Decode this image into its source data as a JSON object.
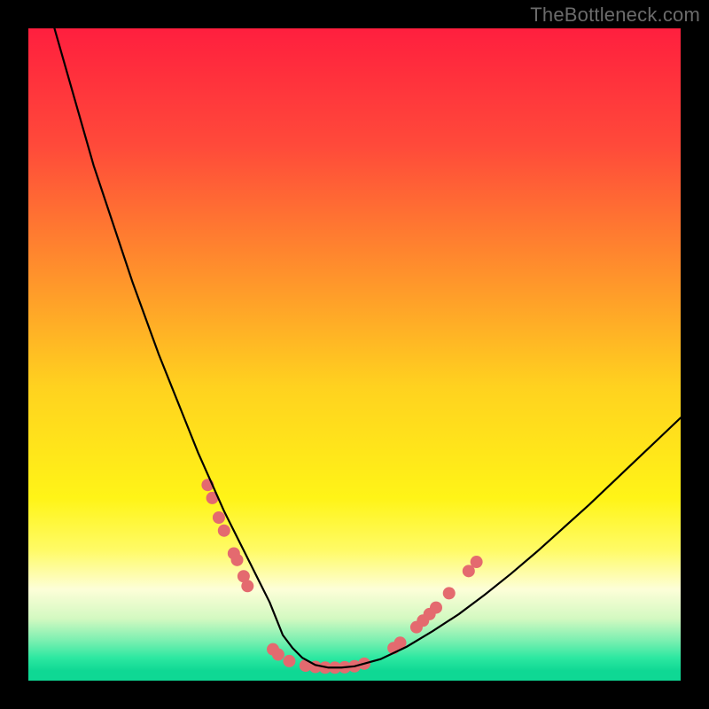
{
  "watermark": "TheBottleneck.com",
  "chart_data": {
    "type": "line",
    "title": "",
    "xlabel": "",
    "ylabel": "",
    "xlim": [
      0,
      100
    ],
    "ylim": [
      0,
      100
    ],
    "grid": false,
    "legend": false,
    "gradient_stops": [
      {
        "offset": 0,
        "color": "#ff1f3e"
      },
      {
        "offset": 0.18,
        "color": "#ff4a3a"
      },
      {
        "offset": 0.4,
        "color": "#ff9a2a"
      },
      {
        "offset": 0.55,
        "color": "#ffd21f"
      },
      {
        "offset": 0.72,
        "color": "#fff417"
      },
      {
        "offset": 0.8,
        "color": "#fffb66"
      },
      {
        "offset": 0.86,
        "color": "#fdfed8"
      },
      {
        "offset": 0.905,
        "color": "#d3f9c1"
      },
      {
        "offset": 0.94,
        "color": "#77efb0"
      },
      {
        "offset": 0.965,
        "color": "#2de8a1"
      },
      {
        "offset": 0.985,
        "color": "#0fd894"
      },
      {
        "offset": 1.0,
        "color": "#0fd894"
      }
    ],
    "series": [
      {
        "name": "bottleneck-curve",
        "color": "#000000",
        "x": [
          4,
          6,
          8,
          10,
          12,
          14,
          16,
          18,
          20,
          22,
          24,
          26,
          28,
          30,
          32,
          34,
          35.5,
          37,
          38,
          39,
          40.5,
          42,
          44,
          46,
          48,
          50,
          54,
          58,
          62,
          66,
          70,
          74,
          78,
          82,
          86,
          90,
          94,
          98,
          100
        ],
        "y": [
          100,
          93,
          86,
          79,
          73,
          67,
          61,
          55.5,
          50,
          45,
          40,
          35,
          30.5,
          26,
          22,
          18,
          15,
          12,
          9.5,
          7,
          5,
          3.5,
          2.4,
          2,
          2,
          2.2,
          3.3,
          5.2,
          7.6,
          10.2,
          13.2,
          16.4,
          19.8,
          23.4,
          27,
          30.8,
          34.6,
          38.4,
          40.3
        ]
      }
    ],
    "scatter": {
      "name": "data-dots",
      "color": "#e46a6f",
      "radius_px": 7,
      "points": [
        {
          "x": 27.5,
          "y": 30
        },
        {
          "x": 28.2,
          "y": 28
        },
        {
          "x": 29.2,
          "y": 25
        },
        {
          "x": 30.0,
          "y": 23
        },
        {
          "x": 31.5,
          "y": 19.5
        },
        {
          "x": 32.0,
          "y": 18.5
        },
        {
          "x": 33.0,
          "y": 16
        },
        {
          "x": 33.6,
          "y": 14.5
        },
        {
          "x": 37.5,
          "y": 4.8
        },
        {
          "x": 38.3,
          "y": 4.0
        },
        {
          "x": 40.0,
          "y": 3.0
        },
        {
          "x": 42.5,
          "y": 2.3
        },
        {
          "x": 44.0,
          "y": 2.1
        },
        {
          "x": 45.5,
          "y": 2.0
        },
        {
          "x": 47.0,
          "y": 2.0
        },
        {
          "x": 48.5,
          "y": 2.05
        },
        {
          "x": 50.0,
          "y": 2.2
        },
        {
          "x": 51.5,
          "y": 2.6
        },
        {
          "x": 56.0,
          "y": 5.0
        },
        {
          "x": 57.0,
          "y": 5.8
        },
        {
          "x": 59.5,
          "y": 8.2
        },
        {
          "x": 60.5,
          "y": 9.2
        },
        {
          "x": 61.5,
          "y": 10.2
        },
        {
          "x": 62.5,
          "y": 11.2
        },
        {
          "x": 64.5,
          "y": 13.4
        },
        {
          "x": 67.5,
          "y": 16.8
        },
        {
          "x": 68.7,
          "y": 18.2
        }
      ]
    }
  }
}
